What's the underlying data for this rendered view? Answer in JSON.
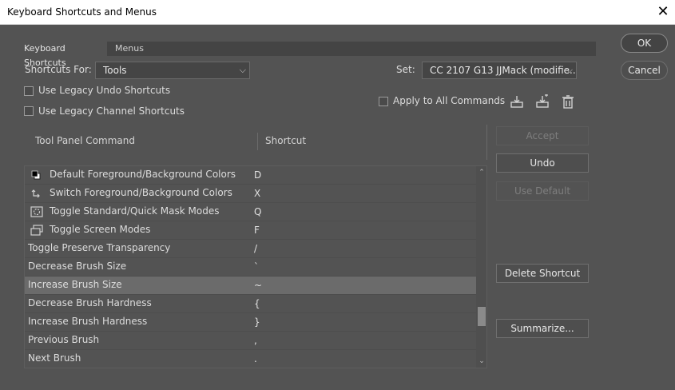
{
  "window": {
    "title": "Keyboard Shortcuts and Menus",
    "close_glyph": "✕"
  },
  "tabs": [
    {
      "label": "Keyboard Shortcuts"
    },
    {
      "label": "Menus"
    }
  ],
  "shortcuts_for": {
    "label": "Shortcuts For:",
    "value": "Tools"
  },
  "set": {
    "label": "Set:",
    "value": "CC 2107 G13 JJMack (modifie..."
  },
  "options": {
    "legacy_undo": "Use Legacy Undo Shortcuts",
    "legacy_channel": "Use Legacy Channel Shortcuts",
    "apply_all": "Apply to All Commands"
  },
  "table": {
    "col_command": "Tool Panel Command",
    "col_shortcut": "Shortcut",
    "rows": [
      {
        "command": "Default Foreground/Background Colors",
        "key": "D",
        "icon": "default-colors-icon"
      },
      {
        "command": "Switch Foreground/Background Colors",
        "key": "X",
        "icon": "switch-colors-icon"
      },
      {
        "command": "Toggle Standard/Quick Mask Modes",
        "key": "Q",
        "icon": "quick-mask-icon"
      },
      {
        "command": "Toggle Screen Modes",
        "key": "F",
        "icon": "screen-mode-icon"
      },
      {
        "command": "Toggle Preserve Transparency",
        "key": "/"
      },
      {
        "command": "Decrease Brush Size",
        "key": "`"
      },
      {
        "command": "Increase Brush Size",
        "key": "~",
        "selected": true
      },
      {
        "command": "Decrease Brush Hardness",
        "key": "{"
      },
      {
        "command": "Increase Brush Hardness",
        "key": "}"
      },
      {
        "command": "Previous Brush",
        "key": ","
      },
      {
        "command": "Next Brush",
        "key": "."
      }
    ]
  },
  "buttons": {
    "ok": "OK",
    "cancel": "Cancel",
    "accept": "Accept",
    "undo": "Undo",
    "use_default": "Use Default",
    "delete_shortcut": "Delete Shortcut",
    "summarize": "Summarize..."
  },
  "glyphs": {
    "chevron_down": "⌵",
    "scroll_up": "⌃",
    "scroll_down": "⌄"
  }
}
